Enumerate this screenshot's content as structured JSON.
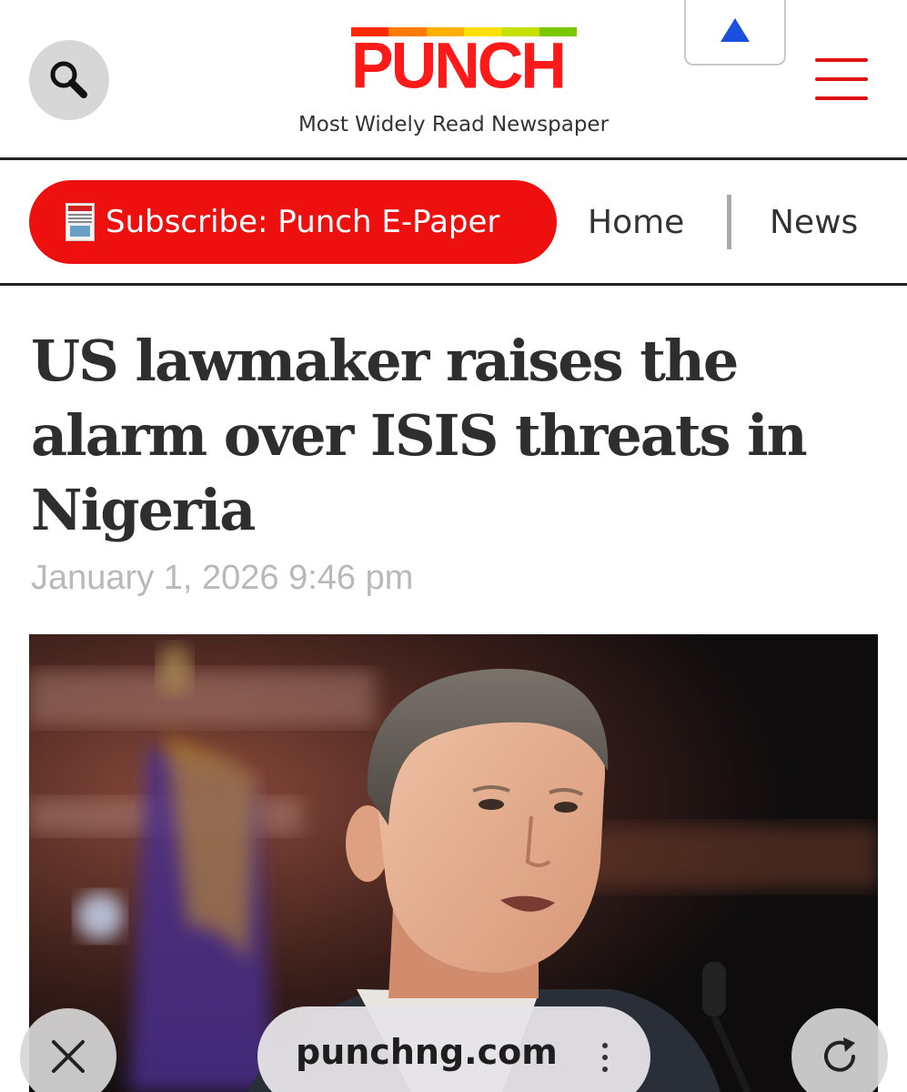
{
  "header": {
    "logo_text": "PUNCH",
    "tagline": "Most Widely Read Newspaper",
    "logo_color": "#ff1a1a",
    "stripe_colors": [
      "#ff2a00",
      "#ff7a00",
      "#ffb000",
      "#ffe000",
      "#c8e000",
      "#7cc800"
    ],
    "menu_color": "#e01010",
    "search_icon": "search-icon",
    "menu_icon": "hamburger-icon",
    "scroll_top_icon": "triangle-up-icon"
  },
  "nav": {
    "subscribe_label": "Subscribe: Punch E-Paper",
    "subscribe_color": "#ee0f0f",
    "items": [
      {
        "label": "Home"
      },
      {
        "label": "News"
      }
    ]
  },
  "article": {
    "headline": "US lawmaker raises the alarm over ISIS threats in Nigeria",
    "date": "January 1, 2026 9:46 pm"
  },
  "browser": {
    "url": "punchng.com",
    "close_icon": "close-icon",
    "reload_icon": "reload-icon",
    "more_icon": "more-vertical-icon"
  }
}
